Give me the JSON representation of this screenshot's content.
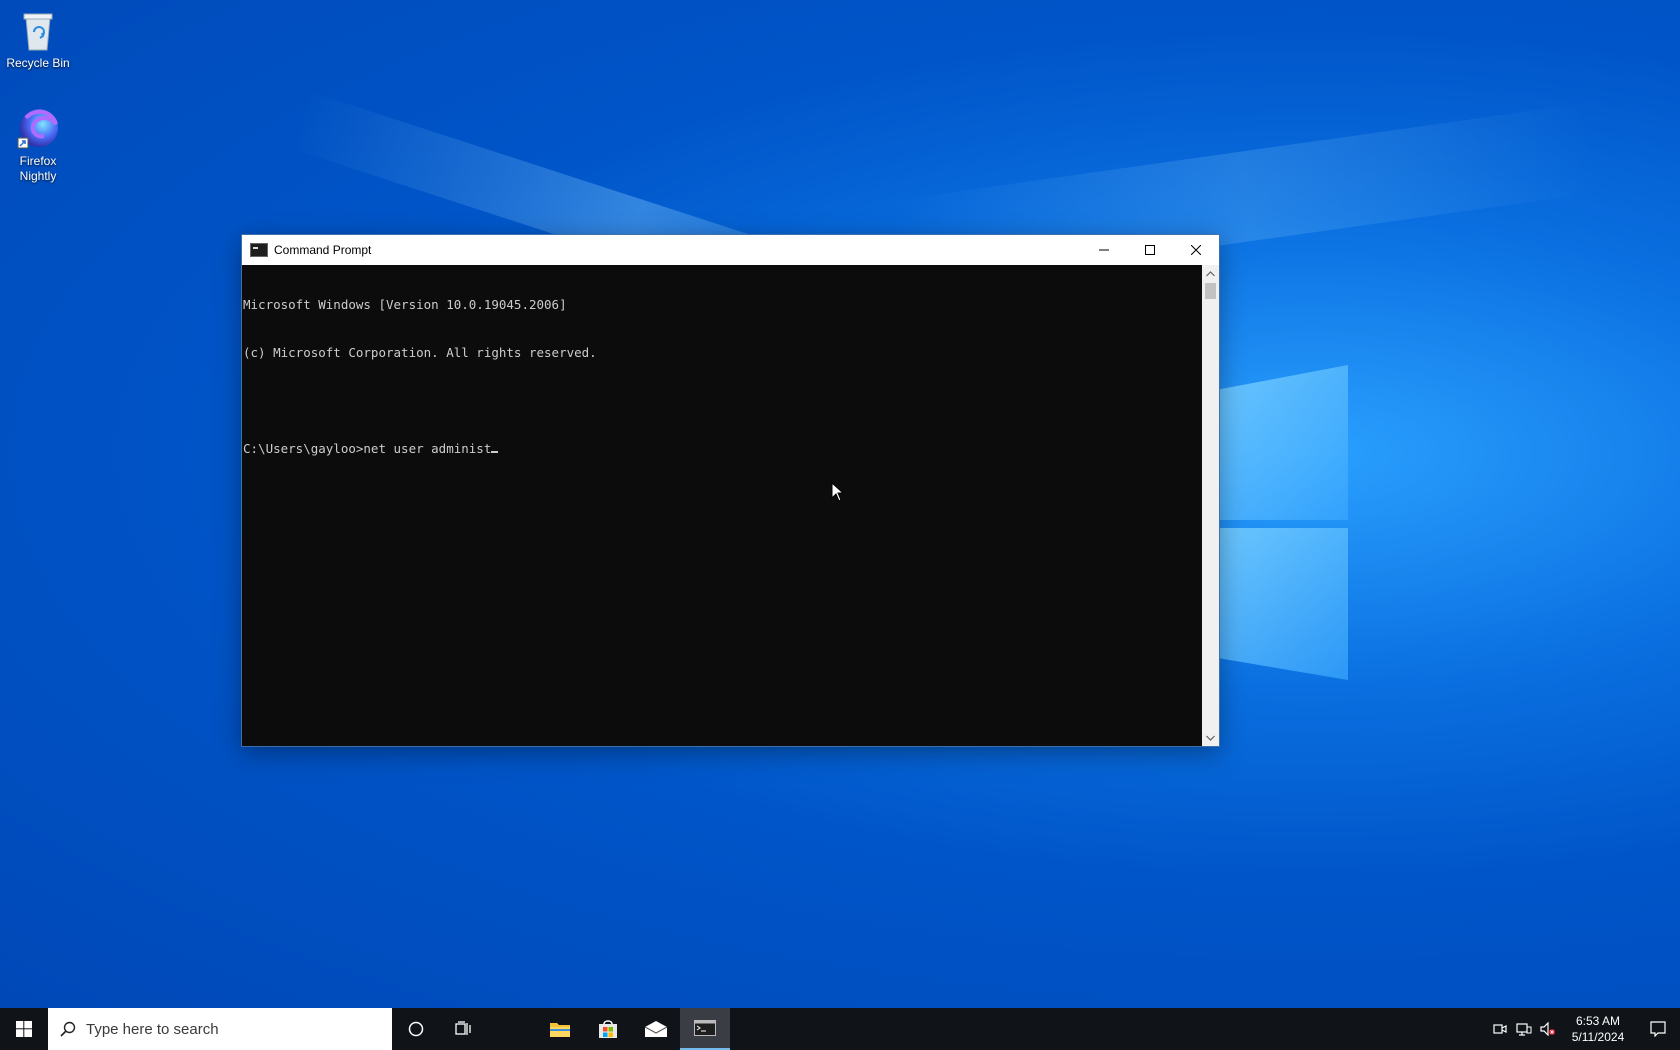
{
  "desktop": {
    "icons": [
      {
        "label": "Recycle Bin",
        "icon": "recycle-bin-icon"
      },
      {
        "label": "Firefox Nightly",
        "icon": "firefox-nightly-icon"
      }
    ]
  },
  "cmd_window": {
    "title": "Command Prompt",
    "icon": "cmd-icon",
    "lines": [
      "Microsoft Windows [Version 10.0.19045.2006]",
      "(c) Microsoft Corporation. All rights reserved.",
      "",
      "C:\\Users\\gayloo>net user administ"
    ],
    "controls": {
      "minimize": "minimize-icon",
      "maximize": "maximize-icon",
      "close": "close-icon"
    }
  },
  "taskbar": {
    "search_placeholder": "Type here to search",
    "apps": [
      {
        "name": "file-explorer",
        "icon": "folder-icon"
      },
      {
        "name": "microsoft-store",
        "icon": "store-icon"
      },
      {
        "name": "mail",
        "icon": "mail-icon"
      },
      {
        "name": "command-prompt",
        "icon": "cmd-icon",
        "active": true
      }
    ],
    "clock": {
      "time": "6:53 AM",
      "date": "5/11/2024"
    }
  },
  "colors": {
    "taskbar_bg": "#101418",
    "console_bg": "#0c0c0c",
    "console_fg": "#cccccc",
    "desktop_blue": "#0a6fe0"
  }
}
